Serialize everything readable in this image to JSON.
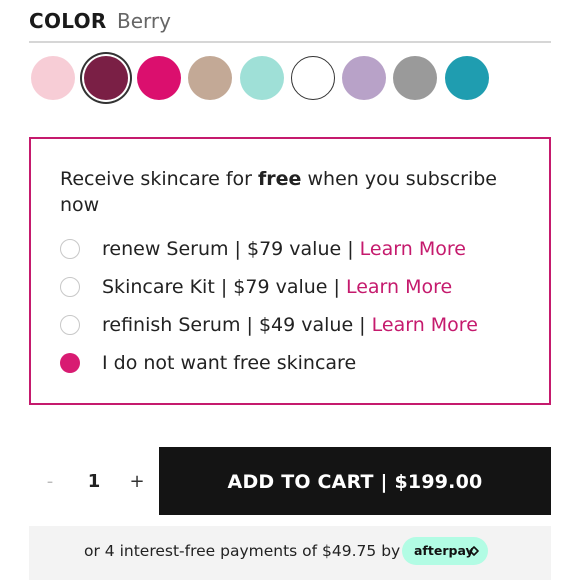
{
  "color": {
    "label": "COLOR",
    "selected_value": "Berry",
    "swatches": [
      {
        "name": "light-pink",
        "color": "#f7cdd6"
      },
      {
        "name": "berry",
        "color": "#7a1f45",
        "selected": true
      },
      {
        "name": "magenta",
        "color": "#db0f6e"
      },
      {
        "name": "taupe",
        "color": "#c3a996"
      },
      {
        "name": "mint",
        "color": "#9fe0d7"
      },
      {
        "name": "white",
        "color": "#ffffff"
      },
      {
        "name": "lavender",
        "color": "#b8a2c8"
      },
      {
        "name": "gray",
        "color": "#9a9a9a"
      },
      {
        "name": "teal",
        "color": "#1f9db0"
      }
    ]
  },
  "subscribe": {
    "title_pre": "Receive skincare for ",
    "title_bold": "free",
    "title_post": " when you subscribe now",
    "options": [
      {
        "text": "renew Serum | $79 value | ",
        "link": "Learn More",
        "checked": false
      },
      {
        "text": "Skincare Kit | $79 value | ",
        "link": "Learn More",
        "checked": false
      },
      {
        "text": "refinish Serum | $49 value | ",
        "link": "Learn More",
        "checked": false
      },
      {
        "text": "I do not want free skincare",
        "link": "",
        "checked": true
      }
    ]
  },
  "quantity": {
    "minus": "-",
    "value": "1",
    "plus": "+"
  },
  "cart": {
    "button_label": "ADD TO CART | $199.00"
  },
  "afterpay": {
    "text": "or 4 interest-free payments of $49.75 by",
    "badge_label": "afterpay"
  },
  "colors": {
    "accent": "#c51a6d",
    "radio_checked": "#d81b72",
    "button_bg": "#141414",
    "afterpay_mint": "#b2fce4"
  }
}
